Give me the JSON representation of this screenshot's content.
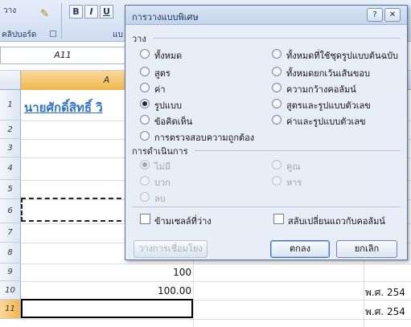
{
  "ribbon": {
    "paste_label": "วาง",
    "clipboard_label": "คลิปบอร์ด",
    "bold": "B",
    "italic": "I",
    "underline": "U",
    "font_group_fragment": "แบ"
  },
  "namebox": {
    "value": "A11"
  },
  "grid": {
    "column_a": "A",
    "rows": [
      "1",
      "2",
      "3",
      "4",
      "5",
      "6",
      "7",
      "8",
      "9",
      "10",
      "11"
    ],
    "selected_row": "11",
    "cells": {
      "a1": "นายศักดิ์สิทธิ์ วิ",
      "a9": "100",
      "a10": "100.00",
      "f10": "พ.ศ. 254",
      "f11": "พ.ศ. 254"
    }
  },
  "dialog": {
    "title": "การวางแบบพิเศษ",
    "help_glyph": "?",
    "close_glyph": "✕",
    "paste_section": "วาง",
    "paste_left": [
      {
        "label": "ทั้งหมด",
        "checked": false
      },
      {
        "label": "สูตร",
        "checked": false
      },
      {
        "label": "ค่า",
        "checked": false
      },
      {
        "label": "รูปแบบ",
        "checked": true
      },
      {
        "label": "ข้อคิดเห็น",
        "checked": false
      },
      {
        "label": "การตรวจสอบความถูกต้อง",
        "checked": false
      }
    ],
    "paste_right": [
      {
        "label": "ทั้งหมดที่ใช้ชุดรูปแบบต้นฉบับ",
        "checked": false
      },
      {
        "label": "ทั้งหมดยกเว้นเส้นขอบ",
        "checked": false
      },
      {
        "label": "ความกว้างคอลัมน์",
        "checked": false
      },
      {
        "label": "สูตรและรูปแบบตัวเลข",
        "checked": false
      },
      {
        "label": "ค่าและรูปแบบตัวเลข",
        "checked": false
      }
    ],
    "operation_section": "การดำเนินการ",
    "operation_left": [
      {
        "label": "ไม่มี",
        "checked": true
      },
      {
        "label": "บวก",
        "checked": false
      },
      {
        "label": "ลบ",
        "checked": false
      }
    ],
    "operation_right": [
      {
        "label": "คูณ",
        "checked": false
      },
      {
        "label": "หาร",
        "checked": false
      }
    ],
    "skip_blanks": {
      "label": "ข้ามเซลล์ที่ว่าง",
      "checked": false
    },
    "transpose": {
      "label": "สลับเปลี่ยนแถวกับคอลัมน์",
      "checked": false
    },
    "paste_link_label": "วางการเชื่อมโยง",
    "ok_label": "ตกลง",
    "cancel_label": "ยกเลิก"
  }
}
